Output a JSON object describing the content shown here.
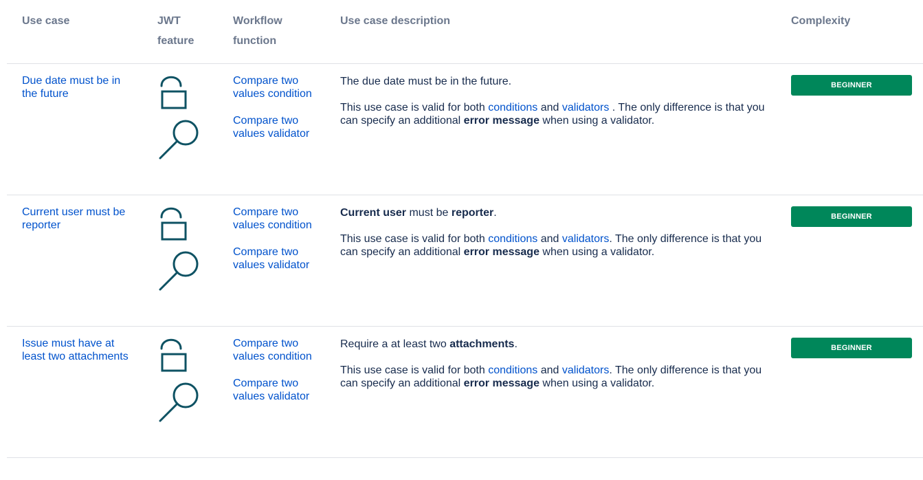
{
  "headers": {
    "use_case": "Use case",
    "jwt_line1": "JWT",
    "jwt_line2": "feature",
    "wf_line1": "Workflow",
    "wf_line2": "function",
    "description": "Use case description",
    "complexity": "Complexity"
  },
  "colors": {
    "link": "#0052cc",
    "header_text": "#6b778c",
    "badge_bg": "#00875a",
    "icon_stroke": "#0e5263"
  },
  "icons": [
    "padlock-icon",
    "magnifier-icon"
  ],
  "rows": [
    {
      "use_case": "Due date must be in the future",
      "wf1": "Compare two values condition",
      "wf2": "Compare two values validator",
      "desc1_pre": "The due date must be in the future.",
      "desc1_bold1": "",
      "desc1_mid": "",
      "desc1_bold2": "",
      "desc1_post": "",
      "desc2_a": "This use case is valid for both ",
      "desc2_link1": "conditions",
      "desc2_b": " and ",
      "desc2_link2": "validators",
      "desc2_c": " . The only difference is that you can specify an additional ",
      "desc2_bold": "error message",
      "desc2_d": " when using a validator.",
      "complexity": "BEGINNER"
    },
    {
      "use_case": "Current user must be reporter",
      "wf1": "Compare two values condition",
      "wf2": "Compare two values validator",
      "desc1_pre": "",
      "desc1_bold1": "Current user",
      "desc1_mid": " must be ",
      "desc1_bold2": "reporter",
      "desc1_post": ".",
      "desc2_a": "This use case is valid for both ",
      "desc2_link1": "conditions",
      "desc2_b": " and ",
      "desc2_link2": "validators",
      "desc2_c": ". The only difference is that you can specify an additional ",
      "desc2_bold": "error message",
      "desc2_d": " when using a validator.",
      "complexity": "BEGINNER"
    },
    {
      "use_case": "Issue must have at least two attachments",
      "wf1": "Compare two values condition",
      "wf2": "Compare two values validator",
      "desc1_pre": "Require a at least two ",
      "desc1_bold1": "attachments",
      "desc1_mid": ".",
      "desc1_bold2": "",
      "desc1_post": "",
      "desc2_a": "This use case is valid for both ",
      "desc2_link1": "conditions",
      "desc2_b": " and ",
      "desc2_link2": "validators",
      "desc2_c": ". The only difference is that you can specify an additional ",
      "desc2_bold": "error message",
      "desc2_d": " when using a validator.",
      "complexity": "BEGINNER"
    }
  ]
}
